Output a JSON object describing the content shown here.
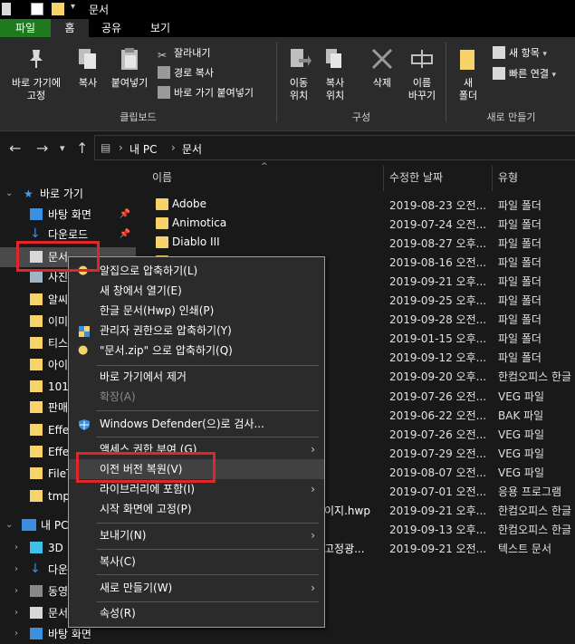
{
  "window": {
    "title": "문서"
  },
  "ribbon": {
    "tabs": [
      "파일",
      "홈",
      "공유",
      "보기"
    ],
    "clipboard": {
      "pin_label": "바로 가기에\n고정",
      "copy_label": "복사",
      "paste_label": "붙여넣기",
      "cut_label": "잘라내기",
      "copy_path_label": "경로 복사",
      "paste_shortcut_label": "바로 가기 붙여넣기",
      "group_label": "클립보드"
    },
    "organize": {
      "move_label": "이동\n위치",
      "copy_to_label": "복사\n위치",
      "delete_label": "삭제",
      "rename_label": "이름\n바꾸기",
      "group_label": "구성"
    },
    "new": {
      "new_folder_label": "새\n폴더",
      "new_item_label": "새 항목",
      "easy_access_label": "빠른 연결",
      "group_label": "새로 만들기"
    }
  },
  "address": {
    "segments": [
      "내 PC",
      "문서"
    ]
  },
  "nav": {
    "quick_access": "바로 가기",
    "items": [
      {
        "label": "바탕 화면",
        "pinned": true
      },
      {
        "label": "다운로드",
        "pinned": true
      },
      {
        "label": "문서",
        "pinned": true
      },
      {
        "label": "사진",
        "pinned": false
      },
      {
        "label": "알씨",
        "pinned": false
      },
      {
        "label": "이미",
        "pinned": false
      },
      {
        "label": "티스",
        "pinned": false
      },
      {
        "label": "아이",
        "pinned": false
      },
      {
        "label": "101",
        "pinned": false
      },
      {
        "label": "판매",
        "pinned": false
      },
      {
        "label": "Effe",
        "pinned": false
      },
      {
        "label": "Effe",
        "pinned": false
      },
      {
        "label": "FileT",
        "pinned": false
      },
      {
        "label": "tmp",
        "pinned": false
      }
    ],
    "this_pc": "내 PC",
    "pc_items": [
      "3D",
      "다운",
      "동영",
      "문서",
      "바탕 화면"
    ]
  },
  "list": {
    "columns": [
      "이름",
      "수정한 날짜",
      "유형"
    ],
    "rows": [
      {
        "name": "Adobe",
        "date": "2019-08-23 오전...",
        "type": "파일 폴더"
      },
      {
        "name": "Animotica",
        "date": "2019-07-24 오전...",
        "type": "파일 폴더"
      },
      {
        "name": "Diablo III",
        "date": "2019-08-27 오후...",
        "type": "파일 폴더"
      },
      {
        "name": "",
        "date": "2019-08-16 오전...",
        "type": "파일 폴더"
      },
      {
        "name": "",
        "date": "2019-09-21 오후...",
        "type": "파일 폴더"
      },
      {
        "name": "",
        "date": "2019-09-25 오후...",
        "type": "파일 폴더"
      },
      {
        "name": "",
        "date": "2019-09-28 오전...",
        "type": "파일 폴더"
      },
      {
        "name": "",
        "date": "2019-01-15 오후...",
        "type": "파일 폴더"
      },
      {
        "name": "",
        "date": "2019-09-12 오후...",
        "type": "파일 폴더"
      },
      {
        "name": "",
        "date": "2019-09-20 오후...",
        "type": "한컴오피스 한글"
      },
      {
        "name": "",
        "date": "2019-07-26 오전...",
        "type": "VEG 파일"
      },
      {
        "name": "",
        "date": "2019-06-22 오전...",
        "type": "BAK 파일"
      },
      {
        "name": "",
        "date": "2019-07-26 오전...",
        "type": "VEG 파일"
      },
      {
        "name": "",
        "date": "2019-07-29 오전...",
        "type": "VEG 파일"
      },
      {
        "name": "",
        "date": "2019-08-07 오전...",
        "type": "VEG 파일"
      },
      {
        "name": "",
        "date": "2019-07-01 오전...",
        "type": "응용 프로그램"
      },
      {
        "name": "이지.hwp",
        "date": "2019-09-21 오후...",
        "type": "한컴오피스 한글"
      },
      {
        "name": "",
        "date": "2019-09-13 오후...",
        "type": "한컴오피스 한글"
      },
      {
        "name": "고정광...",
        "date": "2019-09-21 오전...",
        "type": "텍스트 문서"
      }
    ]
  },
  "context_menu": {
    "items": [
      {
        "label": "알집으로 압축하기(L)",
        "icon": "alzip-icon"
      },
      {
        "label": "새 창에서 열기(E)",
        "icon": ""
      },
      {
        "label": "한글 문서(Hwp) 인쇄(P)",
        "icon": ""
      },
      {
        "label": "관리자 권한으로 압축하기(Y)",
        "icon": "shield-icon"
      },
      {
        "label": "\"문서.zip\" 으로 압축하기(Q)",
        "icon": "alzip-icon"
      },
      {
        "label": "바로 가기에서 제거",
        "icon": ""
      },
      {
        "label": "확장(A)",
        "icon": "",
        "disabled": true
      },
      {
        "label": "Windows Defender(으)로 검사...",
        "icon": "defender-icon"
      },
      {
        "label": "액세스 권한 부여 (G)",
        "icon": "",
        "submenu": true
      },
      {
        "label": "이전 버전 복원(V)",
        "icon": "",
        "highlighted": true
      },
      {
        "label": "라이브러리에 포함(I)",
        "icon": "",
        "submenu": true
      },
      {
        "label": "시작 화면에 고정(P)",
        "icon": ""
      },
      {
        "label": "보내기(N)",
        "icon": "",
        "submenu": true
      },
      {
        "label": "복사(C)",
        "icon": ""
      },
      {
        "label": "새로 만들기(W)",
        "icon": "",
        "submenu": true
      },
      {
        "label": "속성(R)",
        "icon": ""
      }
    ]
  },
  "colors": {
    "accent_tab": "#1f7a1f",
    "highlight_box": "#e0262b",
    "folder": "#f6d46a"
  }
}
